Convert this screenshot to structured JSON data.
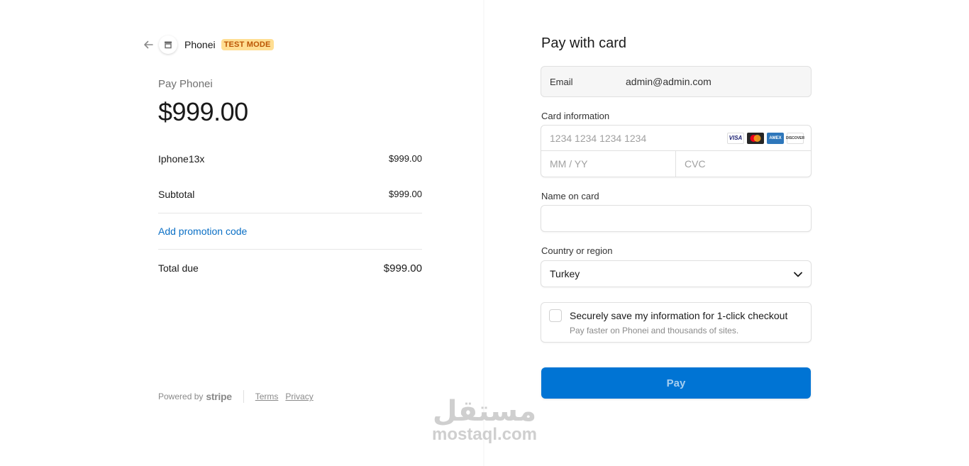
{
  "header": {
    "merchant_name": "Phonei",
    "badge": "TEST MODE"
  },
  "summary": {
    "pay_label": "Pay Phonei",
    "amount": "$999.00",
    "items": [
      {
        "name": "Iphone13x",
        "price": "$999.00"
      }
    ],
    "subtotal_label": "Subtotal",
    "subtotal_value": "$999.00",
    "promo_label": "Add promotion code",
    "total_label": "Total due",
    "total_value": "$999.00"
  },
  "footer": {
    "powered_by": "Powered by",
    "brand": "stripe",
    "terms": "Terms",
    "privacy": "Privacy"
  },
  "form": {
    "title": "Pay with card",
    "email_label": "Email",
    "email_value": "admin@admin.com",
    "card_label": "Card information",
    "card_number_placeholder": "1234 1234 1234 1234",
    "expiry_placeholder": "MM / YY",
    "cvc_placeholder": "CVC",
    "card_brands": [
      "VISA",
      "mastercard",
      "AMEX",
      "DISCOVER"
    ],
    "name_label": "Name on card",
    "name_value": "",
    "country_label": "Country or region",
    "country_value": "Turkey",
    "save_title": "Securely save my information for 1-click checkout",
    "save_subtitle": "Pay faster on Phonei and thousands of sites.",
    "save_checked": false,
    "pay_button": "Pay"
  },
  "watermark": {
    "arabic": "مستقل",
    "latin": "mostaql.com"
  },
  "colors": {
    "accent": "#0074d4",
    "link": "#0a6fc5",
    "badge_bg": "#ffde92",
    "badge_text": "#bb5504"
  }
}
